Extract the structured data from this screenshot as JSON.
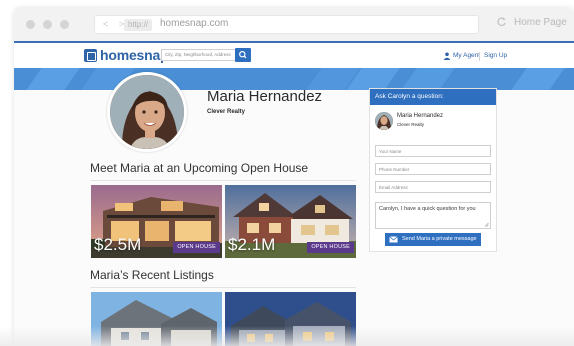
{
  "browser": {
    "nav_arrows": "< >",
    "protocol": "http://",
    "domain": "homesnap.com",
    "home_label": "Home Page"
  },
  "site": {
    "logo": "homesnap",
    "search_placeholder": "City, Zip, Neighborhood, Address",
    "my_agent": "My Agent",
    "sign_up": "Sign Up"
  },
  "agent": {
    "name": "Maria Hernandez",
    "company": "Clever Realty"
  },
  "open_house": {
    "title": "Meet Maria at an Upcoming Open House",
    "listings": [
      {
        "price": "$2.5M",
        "badge": "OPEN HOUSE"
      },
      {
        "price": "$2.1M",
        "badge": "OPEN HOUSE"
      }
    ]
  },
  "recent": {
    "title": "Maria’s Recent Listings"
  },
  "contact_form": {
    "header": "Ask Carolyn a question:",
    "agent_name": "Maria Hernandez",
    "agent_company": "Clever Realty",
    "name_placeholder": "Your Name",
    "phone_placeholder": "Phone Number",
    "email_placeholder": "Email Address",
    "message": "Carolyn, I have a quick question for you",
    "send_label": "Send Maria a private message"
  },
  "colors": {
    "brand_blue": "#2f63a8",
    "button_blue": "#2f6fc0",
    "banner_blue": "#4a8fd6",
    "badge_purple": "#5b3a8c"
  }
}
